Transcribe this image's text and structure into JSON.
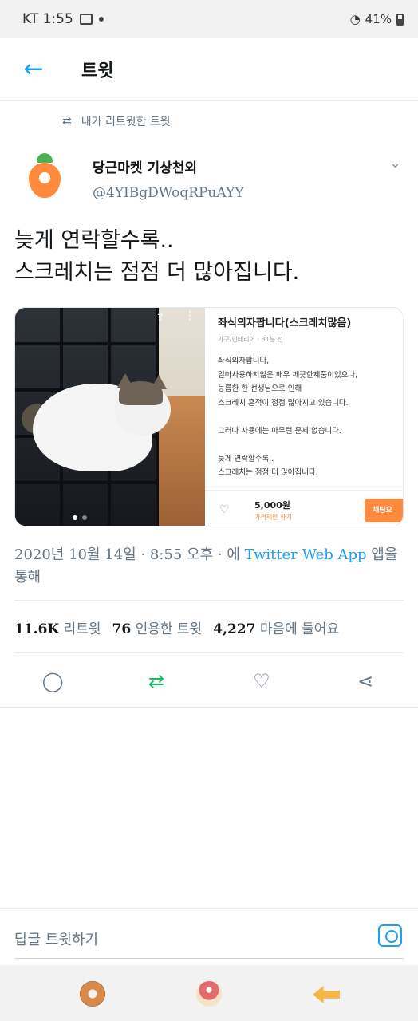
{
  "status_bar": {
    "carrier_time": "KT  1:55",
    "battery": "41%"
  },
  "header": {
    "title": "트윗"
  },
  "retweet_notice": "내가 리트윗한 트윗",
  "author": {
    "name": "당근마켓 기상천외",
    "handle": "@4YIBgDWoqRPuAYY"
  },
  "tweet": {
    "line1": "늦게 연락할수록..",
    "line2": "스크레치는 점점 더 많아집니다."
  },
  "listing": {
    "title": "좌식의자팝니다(스크레치많음)",
    "meta": "가구/인테리어 · 31분 전",
    "desc": [
      "좌식의자팝니다,",
      "얼마사용하지않은 매우 깨끗한제품이었으나,",
      "능름한 한 선생님으로 인해",
      "스크레치 흔적이 점점 많아지고 있습니다.",
      "",
      "그러나 사용에는 아무런 문제 없습니다.",
      "",
      "늦게 연락할수록..",
      "스크레치는 점점 더 많아집니다."
    ],
    "price": "5,000원",
    "nego": "가격제안 하기",
    "chat_button": "채팅으"
  },
  "timestamp": {
    "text": "2020년 10월 14일 · 8:55 오후 · 에 ",
    "source": "Twitter Web App",
    "suffix": " 앱을 통해"
  },
  "stats": {
    "retweets": "11.6K",
    "retweets_label": "리트윗",
    "quotes": "76",
    "quotes_label": "인용한 트윗",
    "likes": "4,227",
    "likes_label": "마음에 들어요"
  },
  "reply_placeholder": "답글 트윗하기",
  "colors": {
    "accent": "#1da1f2",
    "retweet": "#17bf63",
    "carrot": "#ff8a3d"
  }
}
